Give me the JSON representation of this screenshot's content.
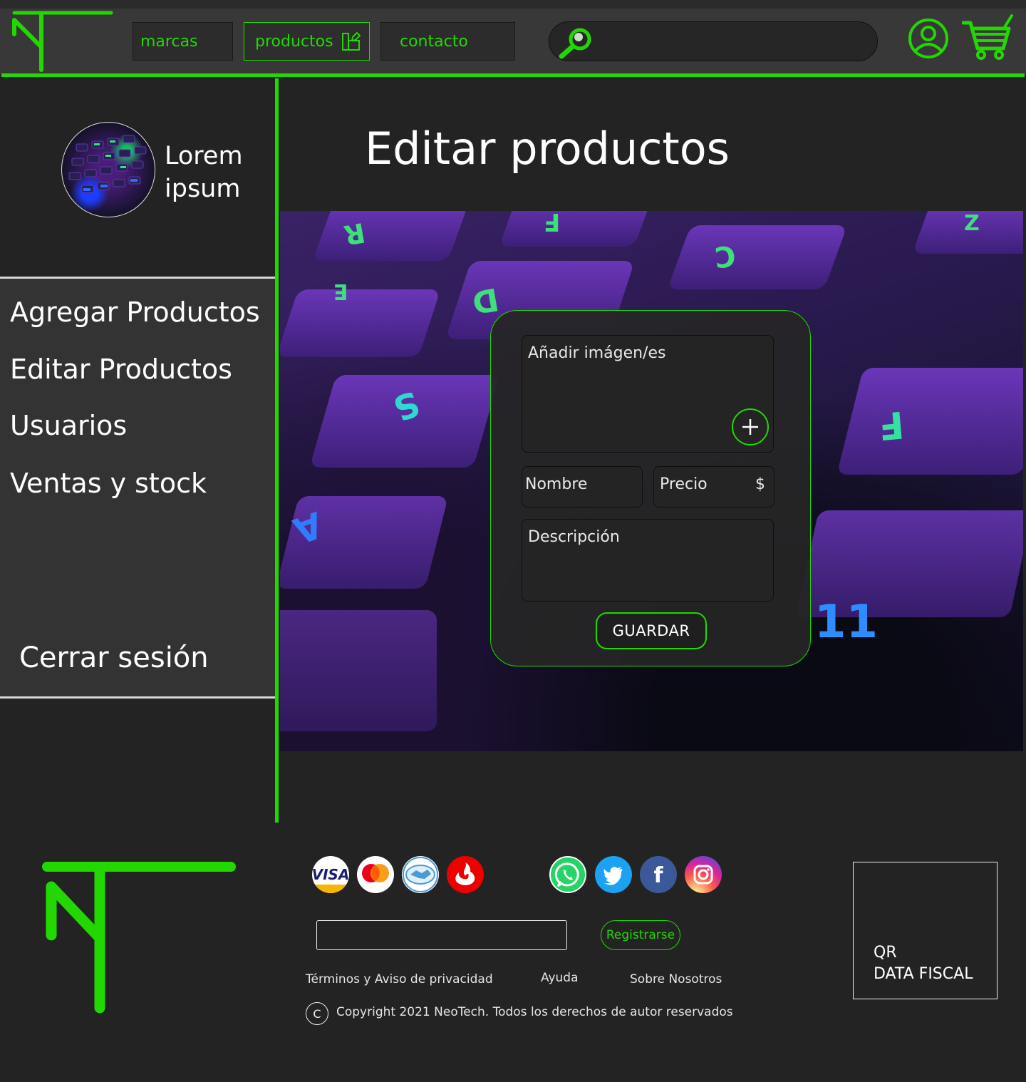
{
  "header": {
    "nav": [
      {
        "label": "marcas"
      },
      {
        "label": "productos"
      },
      {
        "label": "contacto"
      }
    ],
    "search_placeholder": ""
  },
  "sidebar": {
    "profile_name_line1": "Lorem",
    "profile_name_line2": "ipsum",
    "items": [
      {
        "label": "Agregar Productos"
      },
      {
        "label": "Editar Productos"
      },
      {
        "label": "Usuarios"
      },
      {
        "label": "Ventas y stock"
      }
    ],
    "logout_label": "Cerrar sesión"
  },
  "main": {
    "title": "Editar productos",
    "form": {
      "images_label": "Añadir imágen/es",
      "name_label": "Nombre",
      "price_label": "Precio",
      "currency_symbol": "$",
      "description_label": "Descripción",
      "save_label": "GUARDAR"
    }
  },
  "footer": {
    "payment_methods": [
      "visa",
      "mastercard",
      "mercadopago",
      "santander"
    ],
    "payment_visa_text": "VISA",
    "social_networks": [
      "whatsapp",
      "twitter",
      "facebook",
      "instagram"
    ],
    "register_label": "Registrarse",
    "links": [
      {
        "label": "Términos y Aviso de privacidad"
      },
      {
        "label": "Ayuda"
      },
      {
        "label": "Sobre Nosotros"
      }
    ],
    "copyright_symbol": "C",
    "copyright": "Copyright 2021 NeoTech. Todos los derechos de autor reservados",
    "qr_line1": "QR",
    "qr_line2": "DATA FISCAL"
  },
  "colors": {
    "accent": "#22d800",
    "background": "#232323",
    "header": "#383838",
    "panel": "#333333"
  }
}
